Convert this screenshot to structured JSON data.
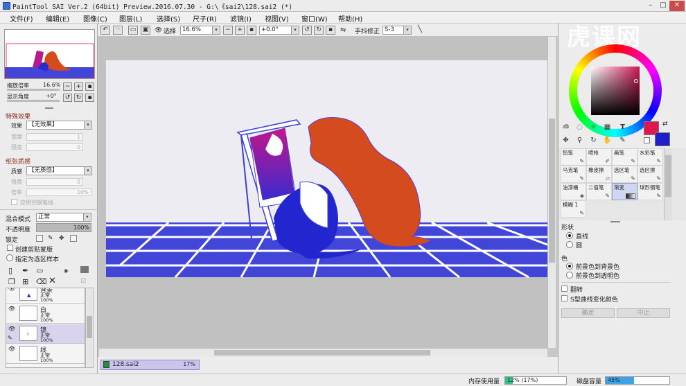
{
  "window": {
    "title": "PaintTool SAI Ver.2 (64bit) Preview.2016.07.30 - G:\\《sai2\\128.sai2 (*)"
  },
  "menu": [
    "文件(F)",
    "编辑(E)",
    "图像(C)",
    "图层(L)",
    "选择(S)",
    "尺子(R)",
    "滤镜(I)",
    "视图(V)",
    "窗口(W)",
    "帮助(H)"
  ],
  "navigator": {
    "zoom_label": "缩放倍率",
    "zoom_value": "16.6%",
    "angle_label": "显示角度",
    "angle_value": "+0°"
  },
  "effects": {
    "section": "特殊效果",
    "effect_label": "效果",
    "effect_value": "【无效果】",
    "width_label": "宽度",
    "width_value": "1",
    "strength_label": "强度",
    "strength_value": "0"
  },
  "paper": {
    "section": "纸张质感",
    "texture_label": "质感",
    "texture_value": "【无质感】",
    "strength_label": "强度",
    "strength_value": "0",
    "scale_label": "倍率",
    "scale_value": "10%",
    "pen_check": "应用到钢笔线"
  },
  "layer_props": {
    "blend_label": "混合模式",
    "blend_value": "正常",
    "opacity_label": "不透明度",
    "opacity_value": "100%",
    "opacity_fraction": 1.0,
    "lock_label": "锁定",
    "clipping_label": "创建剪贴蒙版",
    "sample_label": "指定为选区样本"
  },
  "layers": [
    {
      "name": "背景",
      "mode": "正常",
      "opacity": "100%"
    },
    {
      "name": "白",
      "mode": "正常",
      "opacity": "100%"
    },
    {
      "name": "镜",
      "mode": "正常",
      "opacity": "100%"
    },
    {
      "name": "线",
      "mode": "正常",
      "opacity": "100%"
    }
  ],
  "toolbar": {
    "select_label": "选择",
    "zoom_value": "16.6%",
    "angle_value": "+0.0°",
    "stabilizer_label": "手抖修正",
    "stabilizer_value": "S-3"
  },
  "document": {
    "name": "128.sai2",
    "percent": "17%"
  },
  "status": {
    "memory_label": "内存使用量",
    "memory_value": "12% (17%)",
    "memory_fraction": 0.12,
    "disk_label": "磁盘容量",
    "disk_value": "45%",
    "disk_fraction": 0.45
  },
  "colors": {
    "foreground": "#e0174e",
    "background": "#1f1fc6",
    "canvas_floor": "#4146d8",
    "figure_orange": "#d44b1d",
    "mirror_magenta": "#c2168a"
  },
  "brushes": [
    {
      "label": "铅笔",
      "icon": "pencil-icon"
    },
    {
      "label": "喷枪",
      "icon": "airbrush-icon"
    },
    {
      "label": "画笔",
      "icon": "brush-icon"
    },
    {
      "label": "水彩笔",
      "icon": "watercolor-icon"
    },
    {
      "label": "马克笔",
      "icon": "marker-icon"
    },
    {
      "label": "橡皮擦",
      "icon": "eraser-icon"
    },
    {
      "label": "选区笔",
      "icon": "selpen-icon"
    },
    {
      "label": "选区擦",
      "icon": "selerase-icon"
    },
    {
      "label": "油漆桶",
      "icon": "bucket-icon"
    },
    {
      "label": "二值笔",
      "icon": "binary-pen-icon"
    },
    {
      "label": "渐变",
      "icon": "gradient-icon"
    },
    {
      "label": "球形钢笔",
      "icon": "sphere-pen-icon"
    },
    {
      "label": "模糊 1",
      "icon": "blur-icon"
    }
  ],
  "gradient_opts": {
    "shape_label": "形状",
    "shape_linear": "直线",
    "shape_circle": "圆",
    "color_label": "色",
    "color_fg_bg": "前景色到背景色",
    "color_fg_trans": "前景色到透明色",
    "flip_label": "翻转",
    "scurve_label": "S型曲线变化颜色",
    "ok_label": "确定",
    "cancel_label": "中止"
  },
  "watermark": "虎课网"
}
